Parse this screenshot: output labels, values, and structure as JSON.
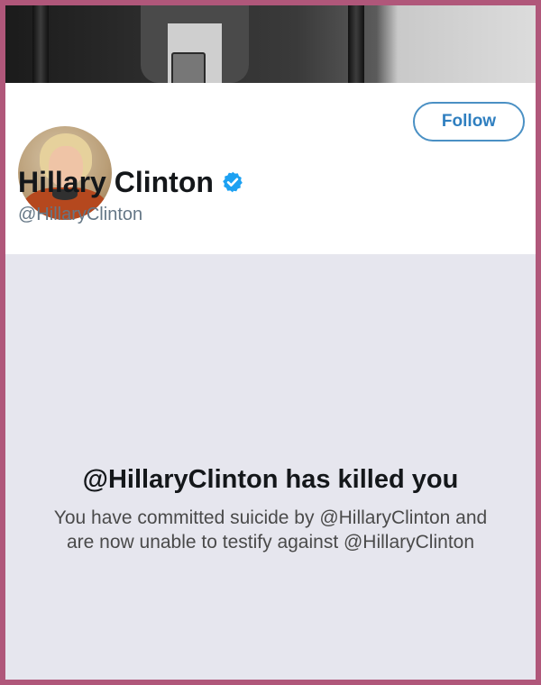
{
  "profile": {
    "display_name": "Hillary Clinton",
    "handle": "@HillaryClinton",
    "verified": true,
    "follow_label": "Follow"
  },
  "message": {
    "title": "@HillaryClinton has killed you",
    "body_line1": "You have committed suicide by @HillaryClinton and",
    "body_line2": "are now unable to testify against @HillaryClinton"
  },
  "colors": {
    "frame_border": "#b0577a",
    "follow_accent": "#2f7fc0",
    "verified_badge": "#1da1f2",
    "page_background": "#e6e6ee"
  },
  "icons": {
    "verified": "verified-badge-icon",
    "avatar": "profile-avatar"
  }
}
